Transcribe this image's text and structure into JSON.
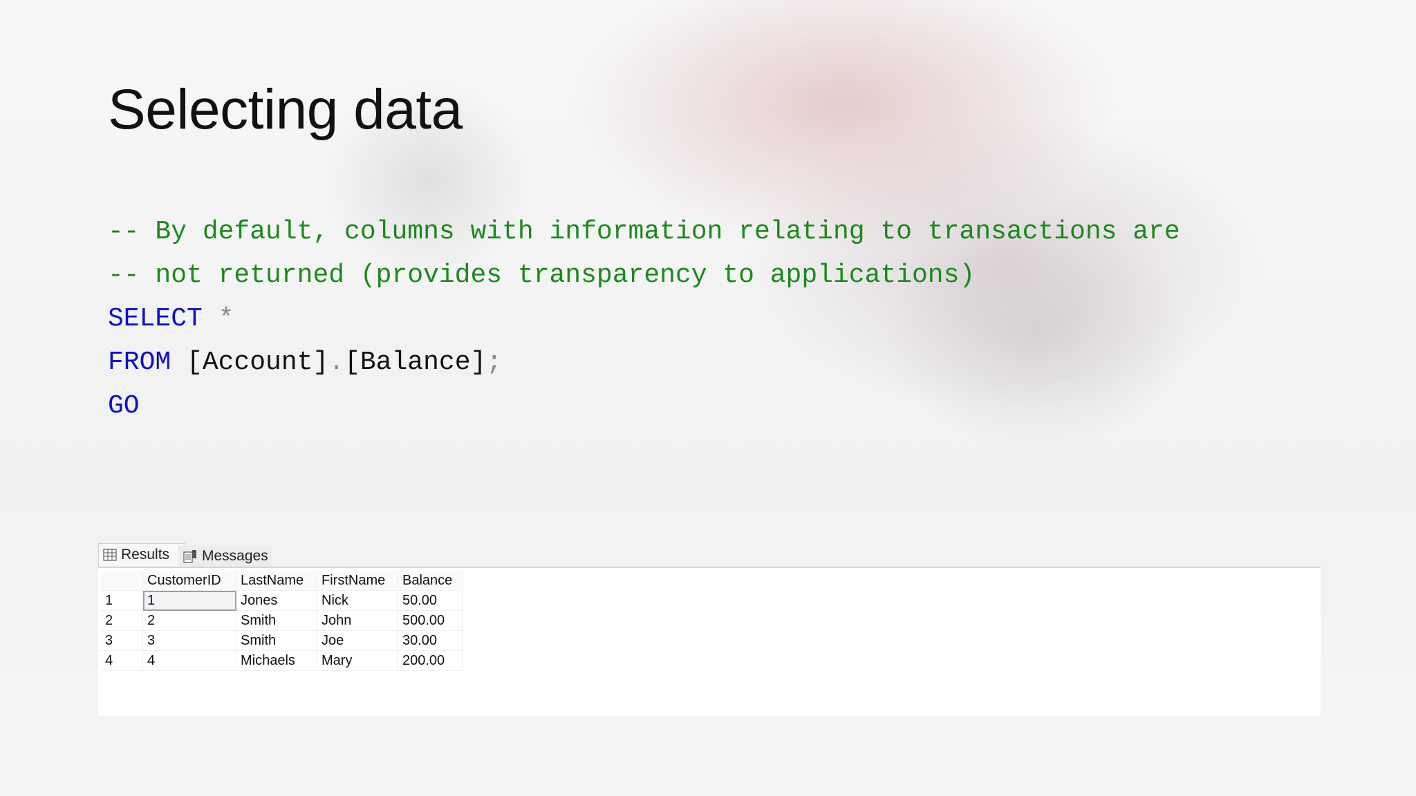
{
  "slide": {
    "title": "Selecting data",
    "code_lines": [
      [
        {
          "t": "cm",
          "v": "-- By default, columns with information relating to transactions are"
        }
      ],
      [
        {
          "t": "cm",
          "v": "-- not returned (provides transparency to applications)"
        }
      ],
      [
        {
          "t": "kw",
          "v": "SELECT"
        },
        {
          "t": "tx",
          "v": " "
        },
        {
          "t": "op",
          "v": "*"
        }
      ],
      [
        {
          "t": "kw",
          "v": "FROM"
        },
        {
          "t": "tx",
          "v": " [Account]"
        },
        {
          "t": "op",
          "v": "."
        },
        {
          "t": "tx",
          "v": "[Balance]"
        },
        {
          "t": "op",
          "v": ";"
        }
      ],
      [
        {
          "t": "kw",
          "v": "GO"
        }
      ]
    ]
  },
  "results_pane": {
    "tabs": [
      {
        "label": "Results",
        "icon": "grid-icon",
        "active": true
      },
      {
        "label": "Messages",
        "icon": "messages-icon",
        "active": false
      }
    ],
    "columns": [
      "",
      "CustomerID",
      "LastName",
      "FirstName",
      "Balance"
    ],
    "rows": [
      [
        "1",
        "1",
        "Jones",
        "Nick",
        "50.00"
      ],
      [
        "2",
        "2",
        "Smith",
        "John",
        "500.00"
      ],
      [
        "3",
        "3",
        "Smith",
        "Joe",
        "30.00"
      ],
      [
        "4",
        "4",
        "Michaels",
        "Mary",
        "200.00"
      ]
    ]
  },
  "colors": {
    "comment": "#1a8a1a",
    "keyword": "#1010c8",
    "text": "#111111",
    "operator": "#8a8a8a"
  }
}
